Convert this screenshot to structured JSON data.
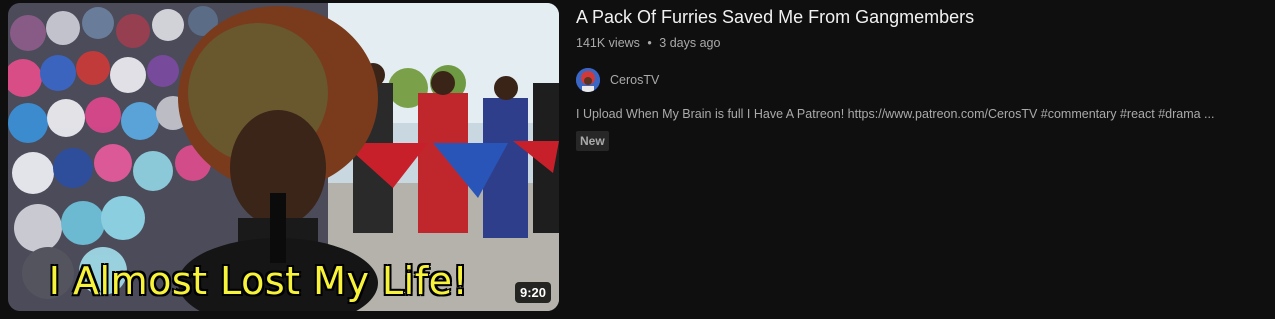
{
  "video": {
    "title": "A Pack Of Furries Saved Me From Gangmembers",
    "views": "141K views",
    "separator": "•",
    "age": "3 days ago",
    "duration": "9:20",
    "thumbnail_caption": "I Almost Lost My Life!",
    "channel_name": "CerosTV",
    "description": "I Upload When My Brain is full I Have A Patreon! https://www.patreon.com/CerosTV #commentary #react #drama ...",
    "badge": "New"
  },
  "colors": {
    "background": "#0f0f0f",
    "caption": "#f7f33a",
    "secondary_text": "#aaaaaa",
    "bandana_red": "#c8202a",
    "bandana_blue": "#2a55b8"
  }
}
